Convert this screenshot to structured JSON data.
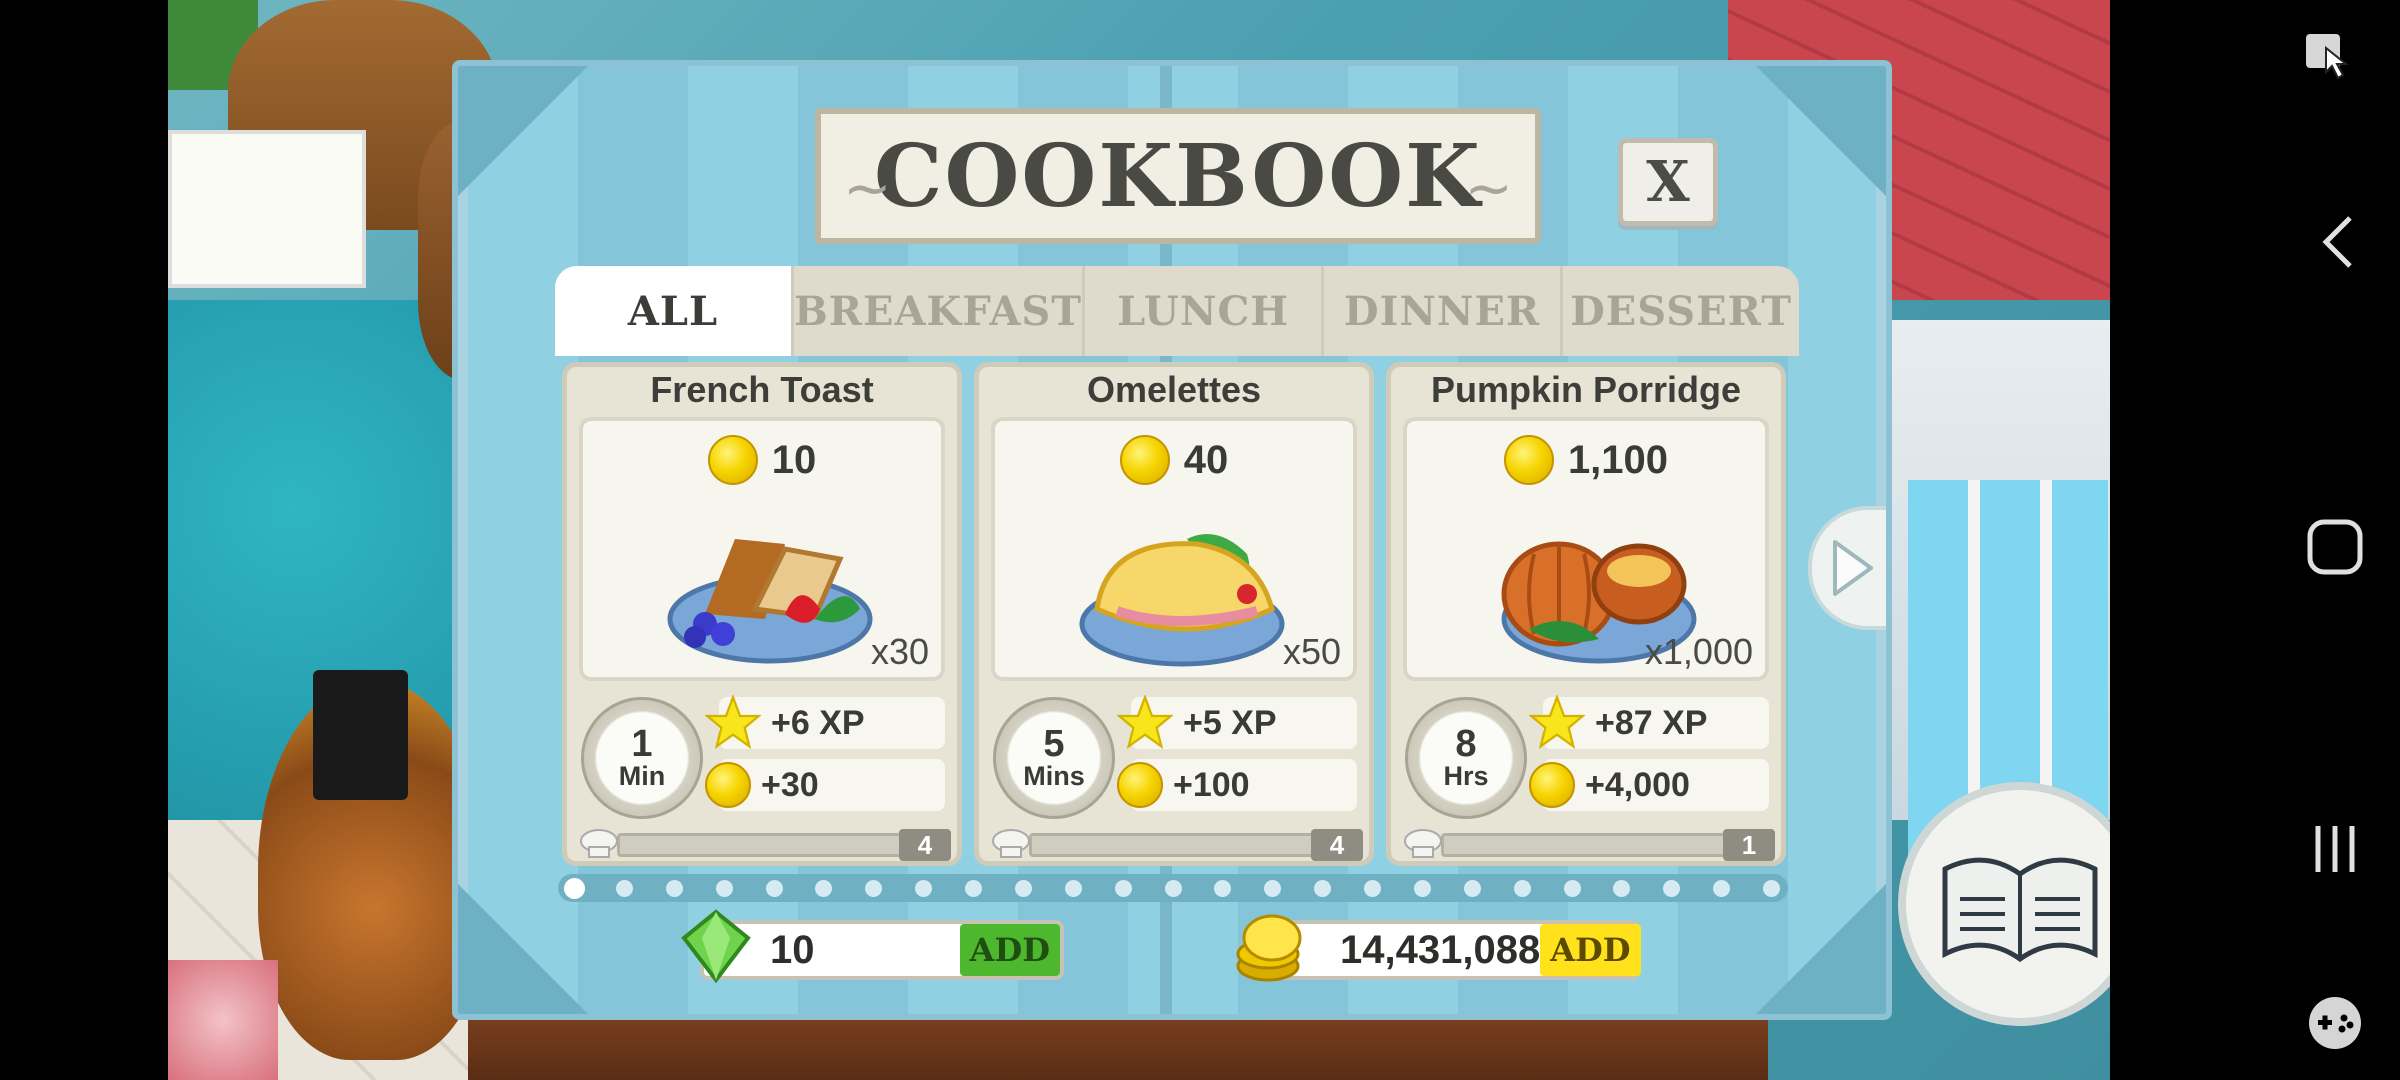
{
  "dialog": {
    "title": "COOKBOOK",
    "close_label": "X"
  },
  "tabs": [
    {
      "label": "ALL",
      "active": true
    },
    {
      "label": "BREAKFAST",
      "active": false
    },
    {
      "label": "LUNCH",
      "active": false
    },
    {
      "label": "DINNER",
      "active": false
    },
    {
      "label": "DESSERT",
      "active": false
    }
  ],
  "recipes": [
    {
      "name": "French Toast",
      "cost": "10",
      "servings": "x30",
      "time_value": "1",
      "time_unit": "Min",
      "xp": "+6 XP",
      "coins": "+30",
      "level": "4"
    },
    {
      "name": "Omelettes",
      "cost": "40",
      "servings": "x50",
      "time_value": "5",
      "time_unit": "Mins",
      "xp": "+5 XP",
      "coins": "+100",
      "level": "4"
    },
    {
      "name": "Pumpkin Porridge",
      "cost": "1,100",
      "servings": "x1,000",
      "time_value": "8",
      "time_unit": "Hrs",
      "xp": "+87 XP",
      "coins": "+4,000",
      "level": "1"
    }
  ],
  "pager": {
    "total_pages": 25,
    "current_page": 1
  },
  "currency": {
    "gems": "10",
    "coins": "14,431,088",
    "gem_add_label": "ADD",
    "coin_add_label": "ADD"
  },
  "colors": {
    "panel": "#8fd0e2",
    "coin": "#f6d400",
    "gem_add": "#4db82e",
    "coin_add": "#ffe21c"
  },
  "icons": [
    "coin-icon",
    "star-icon",
    "timer-icon",
    "chef-hat-icon",
    "gem-icon",
    "next-arrow-icon",
    "cookbook-icon",
    "back-icon",
    "home-icon",
    "recents-icon",
    "gamepad-icon",
    "pointer-icon"
  ]
}
